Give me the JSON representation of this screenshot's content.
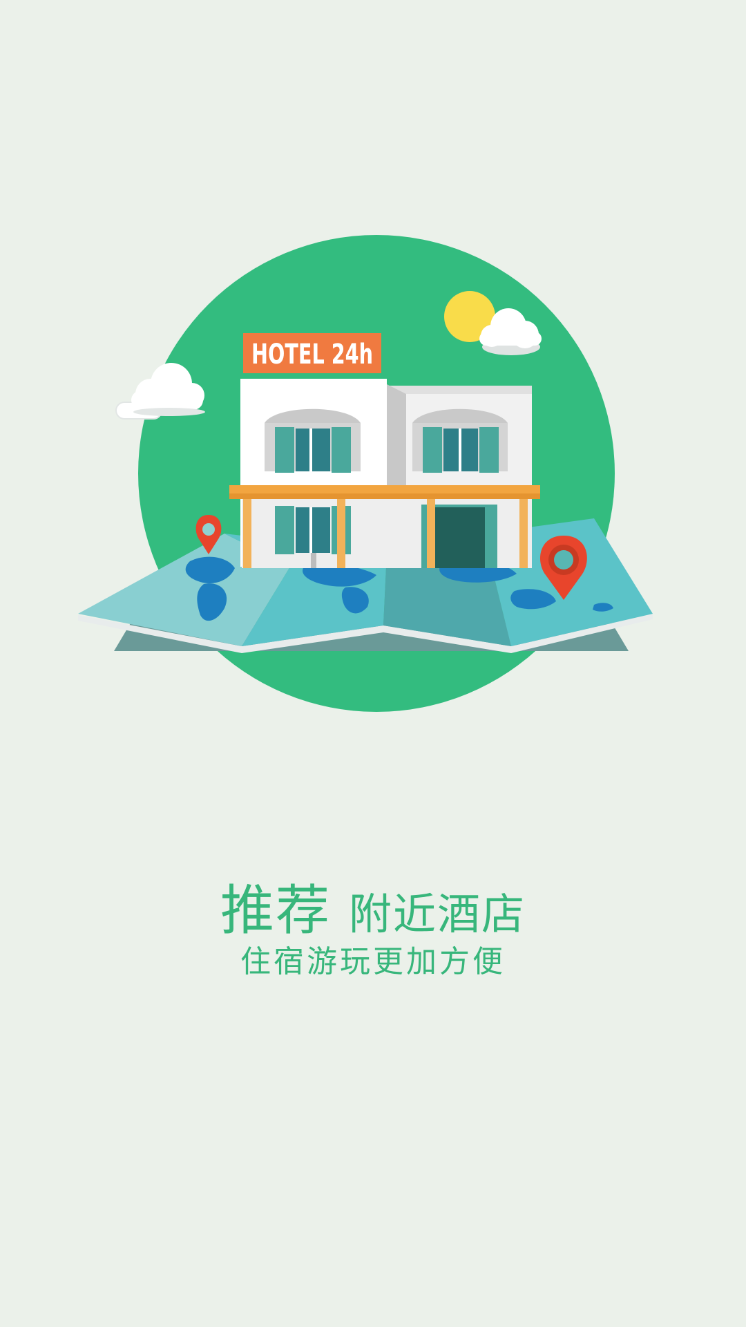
{
  "splash": {
    "title_main": "推荐",
    "title_sub": "附近酒店",
    "subtitle": "住宿游玩更加方便"
  },
  "illustration": {
    "sign_text": "HOTEL 24h",
    "icons": [
      "hotel-building-icon",
      "world-map-icon",
      "location-pin-icon",
      "sun-icon",
      "cloud-icon"
    ]
  },
  "colors": {
    "background": "#ebf1ea",
    "accent_green": "#37b67b",
    "circle_green": "#33bc7f",
    "sign_orange": "#f07a40",
    "pin_red": "#e8452c",
    "map_teal": "#5bc3c8",
    "land_blue": "#1e7fc0",
    "sun_yellow": "#f9dc4a"
  }
}
